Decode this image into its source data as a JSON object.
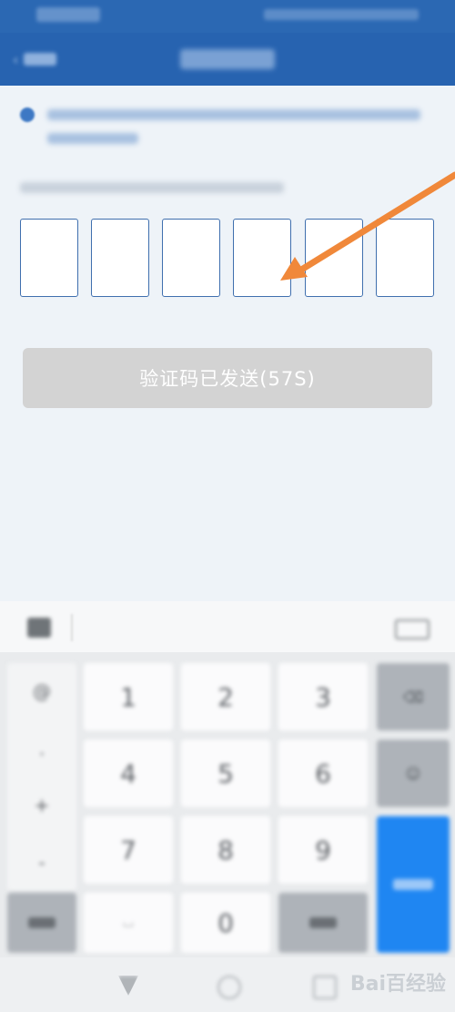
{
  "verify": {
    "send_button_label": "验证码已发送(57S)",
    "code_boxes": [
      "",
      "",
      "",
      "",
      "",
      ""
    ]
  },
  "colors": {
    "primary": "#2763b0",
    "arrow": "#f0883a",
    "accent_key": "#1f86f2",
    "button_disabled": "#d3d3d3"
  },
  "keyboard": {
    "digits": [
      "1",
      "2",
      "3",
      "4",
      "5",
      "6",
      "7",
      "8",
      "9",
      "0"
    ]
  },
  "watermark": "Bai百经验"
}
